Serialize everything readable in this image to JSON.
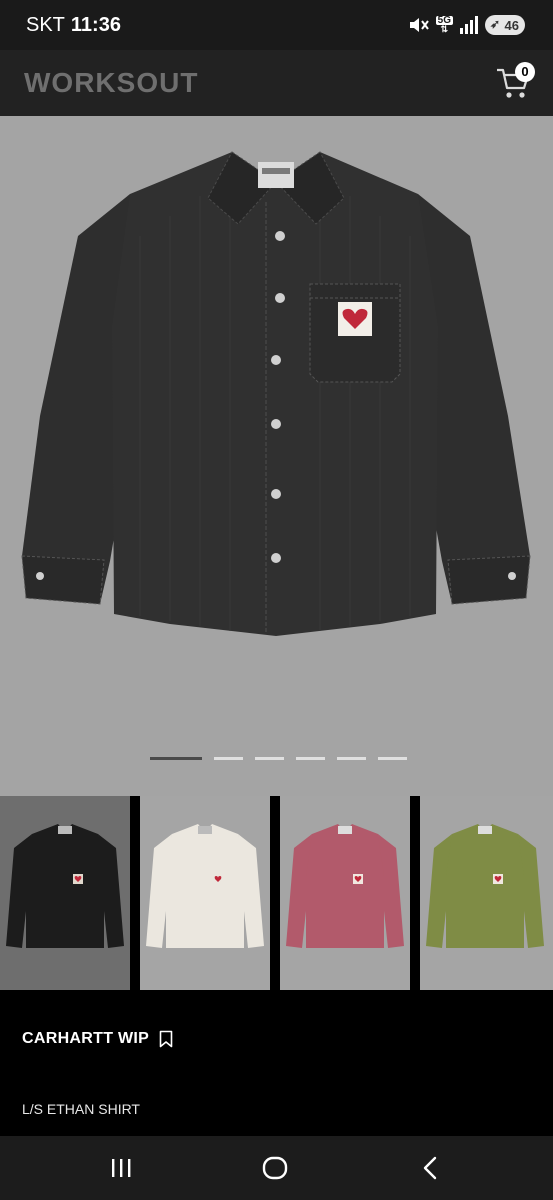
{
  "status_bar": {
    "carrier": "SKT",
    "time": "11:36",
    "network": "5G",
    "battery": "46",
    "icons": [
      "mute-icon",
      "network-5g-icon",
      "signal-icon",
      "battery-icon"
    ]
  },
  "header": {
    "brand": "WORKSOUT",
    "cart_count": "0",
    "cart_icon": "cart-icon"
  },
  "hero": {
    "image": "black-denim-shirt",
    "pager_total": 6,
    "pager_active": 1
  },
  "thumbnails": [
    {
      "color": "black",
      "hex": "#1c1c1c"
    },
    {
      "color": "off-white",
      "hex": "#ebe7df"
    },
    {
      "color": "pink",
      "hex": "#b25a6b"
    },
    {
      "color": "olive",
      "hex": "#7f8c45"
    }
  ],
  "product": {
    "brand": "CARHARTT WIP",
    "name": "L/S ETHAN SHIRT",
    "bookmark_icon": "bookmark-icon"
  },
  "nav": {
    "icons": [
      "recent-apps-icon",
      "home-icon",
      "back-icon"
    ]
  },
  "colors": {
    "header_bg": "#222222",
    "hero_bg": "#a4a4a4",
    "brand_text": "#6f6f6f"
  }
}
